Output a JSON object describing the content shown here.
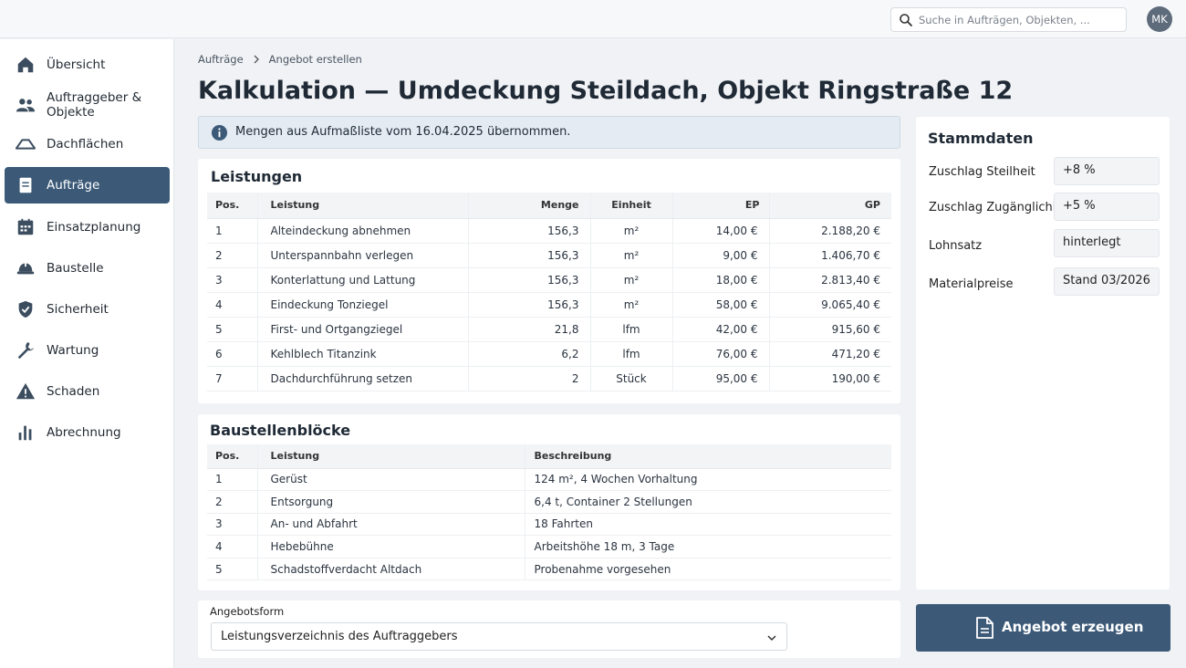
{
  "search": {
    "placeholder": "Suche in Aufträgen, Objekten, ..."
  },
  "user": {
    "initials": "MK"
  },
  "sidebar": {
    "items": [
      {
        "label": "Übersicht",
        "icon": "home-icon"
      },
      {
        "label": "Auftraggeber & Objekte",
        "icon": "people-icon"
      },
      {
        "label": "Dachflächen",
        "icon": "roof-icon"
      },
      {
        "label": "Aufträge",
        "icon": "document-icon",
        "active": true
      },
      {
        "label": "Einsatzplanung",
        "icon": "calendar-icon"
      },
      {
        "label": "Baustelle",
        "icon": "helmet-icon"
      },
      {
        "label": "Sicherheit",
        "icon": "shield-icon"
      },
      {
        "label": "Wartung",
        "icon": "wrench-icon"
      },
      {
        "label": "Schaden",
        "icon": "warning-icon"
      },
      {
        "label": "Abrechnung",
        "icon": "bar-chart-icon"
      }
    ]
  },
  "breadcrumb": {
    "parent": "Aufträge",
    "current": "Angebot erstellen"
  },
  "page": {
    "title": "Kalkulation — Umdeckung Steildach, Objekt Ringstraße 12"
  },
  "info": {
    "text": "Mengen aus Aufmaßliste vom 16.04.2025 übernommen."
  },
  "leistungen": {
    "title": "Leistungen",
    "headers": {
      "pos": "Pos.",
      "leistung": "Leistung",
      "menge": "Menge",
      "einheit": "Einheit",
      "ep": "EP",
      "gp": "GP"
    },
    "rows": [
      {
        "pos": "1",
        "leistung": "Alteindeckung abnehmen",
        "menge": "156,3",
        "einheit": "m²",
        "ep": "14,00 €",
        "gp": "2.188,20 €"
      },
      {
        "pos": "2",
        "leistung": "Unterspannbahn verlegen",
        "menge": "156,3",
        "einheit": "m²",
        "ep": "9,00 €",
        "gp": "1.406,70 €"
      },
      {
        "pos": "3",
        "leistung": "Konterlattung und Lattung",
        "menge": "156,3",
        "einheit": "m²",
        "ep": "18,00 €",
        "gp": "2.813,40 €"
      },
      {
        "pos": "4",
        "leistung": "Eindeckung Tonziegel",
        "menge": "156,3",
        "einheit": "m²",
        "ep": "58,00 €",
        "gp": "9.065,40 €"
      },
      {
        "pos": "5",
        "leistung": "First- und Ortgangziegel",
        "menge": "21,8",
        "einheit": "lfm",
        "ep": "42,00 €",
        "gp": "915,60 €"
      },
      {
        "pos": "6",
        "leistung": "Kehlblech Titanzink",
        "menge": "6,2",
        "einheit": "lfm",
        "ep": "76,00 €",
        "gp": "471,20 €"
      },
      {
        "pos": "7",
        "leistung": "Dachdurchführung setzen",
        "menge": "2",
        "einheit": "Stück",
        "ep": "95,00 €",
        "gp": "190,00 €"
      }
    ]
  },
  "baustellen": {
    "title": "Baustellenblöcke",
    "headers": {
      "pos": "Pos.",
      "leistung": "Leistung",
      "beschreibung": "Beschreibung"
    },
    "rows": [
      {
        "pos": "1",
        "leistung": "Gerüst",
        "beschreibung": "124 m², 4 Wochen Vorhaltung"
      },
      {
        "pos": "2",
        "leistung": "Entsorgung",
        "beschreibung": "6,4 t, Container 2 Stellungen"
      },
      {
        "pos": "3",
        "leistung": "An- und Abfahrt",
        "beschreibung": "18 Fahrten"
      },
      {
        "pos": "4",
        "leistung": "Hebebühne",
        "beschreibung": "Arbeitshöhe 18 m, 3 Tage"
      },
      {
        "pos": "5",
        "leistung": "Schadstoffverdacht Altdach",
        "beschreibung": "Probenahme vorgesehen"
      }
    ]
  },
  "angebotsform": {
    "label": "Angebotsform",
    "value": "Leistungsverzeichnis des Auftraggebers"
  },
  "stammdaten": {
    "title": "Stammdaten",
    "rows": [
      {
        "label": "Zuschlag Steilheit",
        "value": "+8 %"
      },
      {
        "label": "Zuschlag Zugänglichkeit",
        "value": "+5 %"
      },
      {
        "label": "Lohnsatz",
        "value": "hinterlegt"
      },
      {
        "label": "Materialpreise",
        "value": "Stand 03/2026"
      }
    ]
  },
  "action": {
    "label": "Angebot erzeugen"
  },
  "colors": {
    "accent": "#3c5a78",
    "info_bg": "#e4ebf3"
  }
}
